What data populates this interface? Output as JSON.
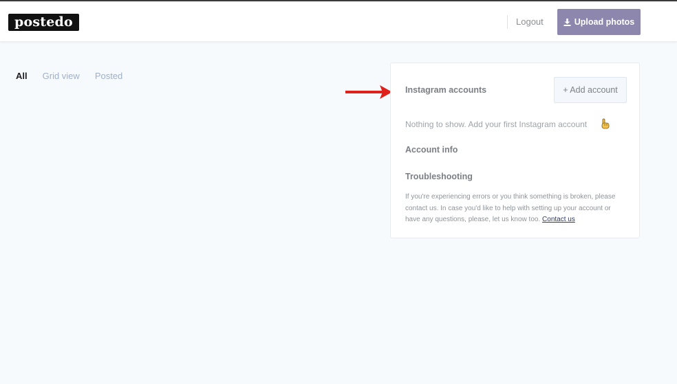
{
  "header": {
    "logo": "postedo",
    "logout_label": "Logout",
    "upload_label": "Upload photos",
    "upload_icon": "download-icon"
  },
  "tabs": [
    {
      "label": "All",
      "active": true
    },
    {
      "label": "Grid view",
      "active": false
    },
    {
      "label": "Posted",
      "active": false
    }
  ],
  "panel": {
    "instagram_title": "Instagram accounts",
    "add_account_label": "+ Add account",
    "empty_message": "Nothing to show. Add your first Instagram account",
    "empty_icon": "pointing-hand-icon",
    "account_info_title": "Account info",
    "troubleshooting_title": "Troubleshooting",
    "troubleshooting_text": "If you're experiencing errors or you think something is broken, please contact us. In case you'd like to help with setting up your account or have any questions, please, let us know too.",
    "contact_label": "Contact us"
  },
  "annotation": {
    "arrow_icon": "red-arrow-icon",
    "arrow_color": "#e0201b"
  },
  "colors": {
    "accent": "#8d87ae",
    "background": "#f7fafd",
    "tab_inactive": "#9fb0c6"
  }
}
